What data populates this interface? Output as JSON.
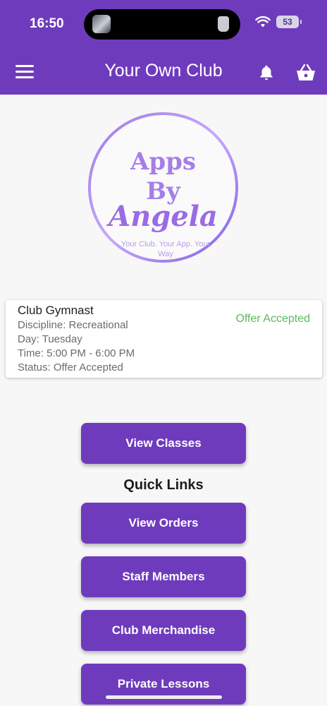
{
  "status_bar": {
    "time": "16:50",
    "battery": "53"
  },
  "app_bar": {
    "title": "Your Own Club"
  },
  "logo": {
    "line1": "Apps",
    "line2": "By",
    "script": "Angela",
    "tagline": "Your Club. Your App. Your Way"
  },
  "card": {
    "title": "Club Gymnast",
    "discipline": "Discipline: Recreational",
    "day": "Day: Tuesday",
    "time": "Time: 5:00 PM - 6:00 PM",
    "status": "Status: Offer Accepted",
    "status_badge": "Offer Accepted"
  },
  "buttons": {
    "view_classes": "View Classes",
    "view_orders": "View Orders",
    "staff_members": "Staff Members",
    "club_merchandise": "Club Merchandise",
    "private_lessons": "Private Lessons"
  },
  "section": {
    "quick_links": "Quick Links"
  },
  "colors": {
    "primary": "#6f3bbd",
    "accepted": "#5cb85c",
    "background": "#f7f7f7"
  },
  "icons": [
    "menu-icon",
    "bell-icon",
    "basket-icon",
    "wifi-icon",
    "battery-icon"
  ]
}
